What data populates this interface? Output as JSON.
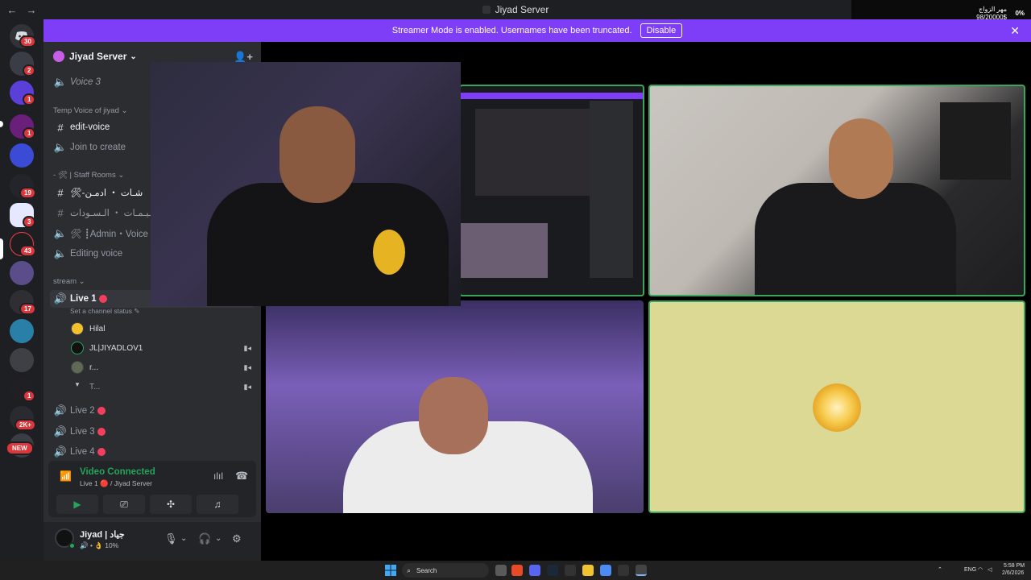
{
  "window": {
    "title": "Jiyad Server",
    "back_glyph": "←",
    "forward_glyph": "→"
  },
  "banner": {
    "text": "Streamer Mode is enabled. Usernames have been truncated.",
    "button": "Disable",
    "close_glyph": "✕"
  },
  "widget": {
    "line1": "مهر الزواج",
    "line2": "98/20000$",
    "percent": "0%"
  },
  "rail": {
    "badges": [
      "30",
      "2",
      "1",
      "1",
      "3",
      "43",
      "19",
      "17",
      "1",
      "2K+"
    ],
    "new_label": "NEW"
  },
  "server": {
    "name": "Jiyad Server",
    "chevron": "⌄",
    "invite_glyph": "👤+"
  },
  "channels": {
    "voice3": "Voice 3",
    "cat_temp": "Temp Voice of jiyad",
    "edit_voice": "edit-voice",
    "join_create": "Join to create",
    "cat_staff": "- 🛠 | Staff Rooms",
    "staff_chat": "🛠-شـات ・ ادمـن",
    "settings": "تـظـيـمـات ・ الـسـودات┋❖",
    "admin_voice": "🛠 ┋Admin・Voice",
    "editing_voice": "Editing voice",
    "cat_stream": "stream",
    "live1": "Live 1",
    "live1_status": "Set a channel status ✎",
    "live2": "Live 2",
    "live3": "Live 3",
    "live4": "Live 4"
  },
  "voice_users": [
    {
      "name": "Hilal",
      "cam": ""
    },
    {
      "name": "JL|JIYADLOV1",
      "cam": "▮◂"
    },
    {
      "name": "r...",
      "cam": "▮◂"
    },
    {
      "name": "T...",
      "cam": "▮◂"
    }
  ],
  "voice_panel": {
    "status": "Video Connected",
    "location": "Live 1 🔴 / Jiyad Server",
    "signal_glyph": "📶",
    "wave_glyph": "ılıl",
    "hangup_glyph": "☎",
    "camera_glyph": "▶",
    "screen_glyph": "⎚",
    "activity_glyph": "✣",
    "soundboard_glyph": "♫"
  },
  "user_panel": {
    "name": "Jiyad | جياد",
    "sub": "🔊 • 👌 10%",
    "mic_glyph": "🎙",
    "headset_glyph": "🎧",
    "settings_glyph": "⚙",
    "caret_glyph": "⌄"
  },
  "taskbar": {
    "search": "Search",
    "lang": "ENG",
    "time": "5:58 PM",
    "date": "2/6/2026"
  },
  "colors": {
    "accent": "#7e3df6",
    "online": "#23a55a",
    "live_dot": "#f23f5e",
    "badge": "#da373c",
    "sidebar": "#2b2d31",
    "rail": "#1e1f22",
    "speaking_border": "#3ba55c",
    "sun_tile_bg": "#dcd994"
  }
}
